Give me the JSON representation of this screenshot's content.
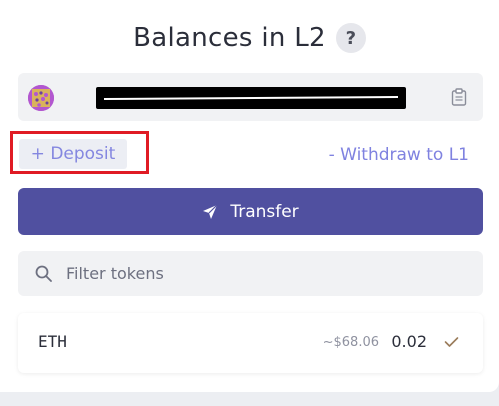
{
  "header": {
    "title": "Balances in L2",
    "help_symbol": "?"
  },
  "account": {
    "avatar_icon": "identicon-avatar",
    "address_redacted": true,
    "copy_icon": "clipboard-icon"
  },
  "actions": {
    "deposit_label": "+ Deposit",
    "withdraw_label": "- Withdraw to L1",
    "transfer_label": "Transfer",
    "transfer_icon": "send-icon"
  },
  "filter": {
    "placeholder": "Filter tokens",
    "value": "",
    "icon": "search-icon"
  },
  "tokens": [
    {
      "symbol": "ETH",
      "usd_value": "~$68.06",
      "amount": "0.02",
      "status_icon": "check-icon"
    }
  ],
  "colors": {
    "accent": "#5050a0",
    "link": "#8487e0",
    "highlight_border": "#e01b24"
  }
}
